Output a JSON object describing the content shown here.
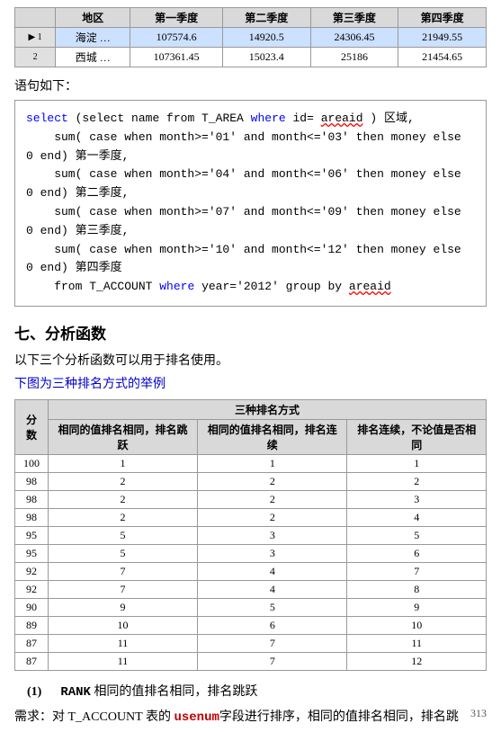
{
  "top_table": {
    "headers": [
      "",
      "地区",
      "第一季度",
      "第二季度",
      "第三季度",
      "第四季度"
    ],
    "rows": [
      {
        "arrow": true,
        "num": "1",
        "area": "海淀 …",
        "q1": "107574.6",
        "q2": "14920.5",
        "q3": "24306.45",
        "q4": "21949.55"
      },
      {
        "arrow": false,
        "num": "2",
        "area": "西城 …",
        "q1": "107361.45",
        "q2": "15023.4",
        "q3": "25186",
        "q4": "21454.65"
      }
    ]
  },
  "section_label": "语句如下：",
  "code_lines": [
    {
      "parts": [
        {
          "text": "select",
          "class": "kw"
        },
        {
          "text": "  (select name from T_AREA ",
          "class": ""
        },
        {
          "text": "where",
          "class": "kw"
        },
        {
          "text": " id= ",
          "class": ""
        },
        {
          "text": "areaid",
          "class": "underline-red"
        },
        {
          "text": " ) 区域,",
          "class": ""
        }
      ]
    },
    {
      "parts": [
        {
          "text": "    sum( case when month>='01' and month<='03' then money else",
          "class": ""
        }
      ]
    },
    {
      "parts": [
        {
          "text": "0",
          "class": ""
        },
        {
          "text": " end) ",
          "class": ""
        },
        {
          "text": "第一季度,",
          "class": ""
        }
      ]
    },
    {
      "parts": [
        {
          "text": "    sum( case when month>='04' and month<='06' then money else",
          "class": ""
        }
      ]
    },
    {
      "parts": [
        {
          "text": "0",
          "class": ""
        },
        {
          "text": " end) ",
          "class": ""
        },
        {
          "text": "第二季度,",
          "class": ""
        }
      ]
    },
    {
      "parts": [
        {
          "text": "    sum( case when month>='07' and month<='09' then money else",
          "class": ""
        }
      ]
    },
    {
      "parts": [
        {
          "text": "0",
          "class": ""
        },
        {
          "text": " end) ",
          "class": ""
        },
        {
          "text": "第三季度,",
          "class": ""
        }
      ]
    },
    {
      "parts": [
        {
          "text": "    sum( case when month>='10' and month<='12' then money else",
          "class": ""
        }
      ]
    },
    {
      "parts": [
        {
          "text": "0",
          "class": ""
        },
        {
          "text": " end) ",
          "class": ""
        },
        {
          "text": "第四季度",
          "class": ""
        }
      ]
    },
    {
      "parts": [
        {
          "text": "    from T_ACCOUNT ",
          "class": ""
        },
        {
          "text": "where",
          "class": "kw"
        },
        {
          "text": " year='2012' group by ",
          "class": ""
        },
        {
          "text": "areaid",
          "class": "underline-red"
        }
      ]
    }
  ],
  "section7_title": "七、分析函数",
  "intro_text": "以下三个分析函数可以用于排名使用。",
  "table_caption_blue": "下图为三种排名方式的举例",
  "rank_table": {
    "title": "三种排名方式",
    "col_headers": [
      "分数",
      "相同的值排名相同，排名跳跃",
      "相同的值排名相同，排名连续",
      "排名连续，不论值是否相同"
    ],
    "rows": [
      [
        "100",
        "1",
        "1",
        "1"
      ],
      [
        "98",
        "2",
        "2",
        "2"
      ],
      [
        "98",
        "2",
        "2",
        "3"
      ],
      [
        "98",
        "2",
        "2",
        "4"
      ],
      [
        "95",
        "5",
        "3",
        "5"
      ],
      [
        "95",
        "5",
        "3",
        "6"
      ],
      [
        "92",
        "7",
        "4",
        "7"
      ],
      [
        "92",
        "7",
        "4",
        "8"
      ],
      [
        "90",
        "9",
        "5",
        "9"
      ],
      [
        "89",
        "10",
        "6",
        "10"
      ],
      [
        "87",
        "11",
        "7",
        "11"
      ],
      [
        "87",
        "11",
        "7",
        "12"
      ]
    ]
  },
  "rank_item": {
    "num": "(1)",
    "fn": "RANK",
    "desc": "  相同的值排名相同，排名跳跃"
  },
  "bottom_text_prefix": "需求：对 T_ACCOUNT 表的 ",
  "bottom_text_code": "usenum",
  "bottom_text_suffix": "字段进行排序，相同的值排名相同，排名跳",
  "page_number": "313"
}
